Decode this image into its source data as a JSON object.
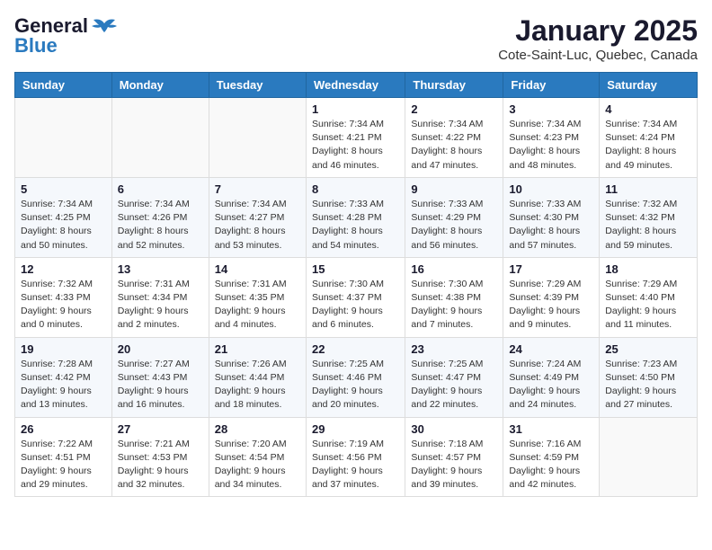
{
  "header": {
    "logo_general": "General",
    "logo_blue": "Blue",
    "month_title": "January 2025",
    "location": "Cote-Saint-Luc, Quebec, Canada"
  },
  "weekdays": [
    "Sunday",
    "Monday",
    "Tuesday",
    "Wednesday",
    "Thursday",
    "Friday",
    "Saturday"
  ],
  "weeks": [
    [
      {
        "day": "",
        "info": ""
      },
      {
        "day": "",
        "info": ""
      },
      {
        "day": "",
        "info": ""
      },
      {
        "day": "1",
        "info": "Sunrise: 7:34 AM\nSunset: 4:21 PM\nDaylight: 8 hours and 46 minutes."
      },
      {
        "day": "2",
        "info": "Sunrise: 7:34 AM\nSunset: 4:22 PM\nDaylight: 8 hours and 47 minutes."
      },
      {
        "day": "3",
        "info": "Sunrise: 7:34 AM\nSunset: 4:23 PM\nDaylight: 8 hours and 48 minutes."
      },
      {
        "day": "4",
        "info": "Sunrise: 7:34 AM\nSunset: 4:24 PM\nDaylight: 8 hours and 49 minutes."
      }
    ],
    [
      {
        "day": "5",
        "info": "Sunrise: 7:34 AM\nSunset: 4:25 PM\nDaylight: 8 hours and 50 minutes."
      },
      {
        "day": "6",
        "info": "Sunrise: 7:34 AM\nSunset: 4:26 PM\nDaylight: 8 hours and 52 minutes."
      },
      {
        "day": "7",
        "info": "Sunrise: 7:34 AM\nSunset: 4:27 PM\nDaylight: 8 hours and 53 minutes."
      },
      {
        "day": "8",
        "info": "Sunrise: 7:33 AM\nSunset: 4:28 PM\nDaylight: 8 hours and 54 minutes."
      },
      {
        "day": "9",
        "info": "Sunrise: 7:33 AM\nSunset: 4:29 PM\nDaylight: 8 hours and 56 minutes."
      },
      {
        "day": "10",
        "info": "Sunrise: 7:33 AM\nSunset: 4:30 PM\nDaylight: 8 hours and 57 minutes."
      },
      {
        "day": "11",
        "info": "Sunrise: 7:32 AM\nSunset: 4:32 PM\nDaylight: 8 hours and 59 minutes."
      }
    ],
    [
      {
        "day": "12",
        "info": "Sunrise: 7:32 AM\nSunset: 4:33 PM\nDaylight: 9 hours and 0 minutes."
      },
      {
        "day": "13",
        "info": "Sunrise: 7:31 AM\nSunset: 4:34 PM\nDaylight: 9 hours and 2 minutes."
      },
      {
        "day": "14",
        "info": "Sunrise: 7:31 AM\nSunset: 4:35 PM\nDaylight: 9 hours and 4 minutes."
      },
      {
        "day": "15",
        "info": "Sunrise: 7:30 AM\nSunset: 4:37 PM\nDaylight: 9 hours and 6 minutes."
      },
      {
        "day": "16",
        "info": "Sunrise: 7:30 AM\nSunset: 4:38 PM\nDaylight: 9 hours and 7 minutes."
      },
      {
        "day": "17",
        "info": "Sunrise: 7:29 AM\nSunset: 4:39 PM\nDaylight: 9 hours and 9 minutes."
      },
      {
        "day": "18",
        "info": "Sunrise: 7:29 AM\nSunset: 4:40 PM\nDaylight: 9 hours and 11 minutes."
      }
    ],
    [
      {
        "day": "19",
        "info": "Sunrise: 7:28 AM\nSunset: 4:42 PM\nDaylight: 9 hours and 13 minutes."
      },
      {
        "day": "20",
        "info": "Sunrise: 7:27 AM\nSunset: 4:43 PM\nDaylight: 9 hours and 16 minutes."
      },
      {
        "day": "21",
        "info": "Sunrise: 7:26 AM\nSunset: 4:44 PM\nDaylight: 9 hours and 18 minutes."
      },
      {
        "day": "22",
        "info": "Sunrise: 7:25 AM\nSunset: 4:46 PM\nDaylight: 9 hours and 20 minutes."
      },
      {
        "day": "23",
        "info": "Sunrise: 7:25 AM\nSunset: 4:47 PM\nDaylight: 9 hours and 22 minutes."
      },
      {
        "day": "24",
        "info": "Sunrise: 7:24 AM\nSunset: 4:49 PM\nDaylight: 9 hours and 24 minutes."
      },
      {
        "day": "25",
        "info": "Sunrise: 7:23 AM\nSunset: 4:50 PM\nDaylight: 9 hours and 27 minutes."
      }
    ],
    [
      {
        "day": "26",
        "info": "Sunrise: 7:22 AM\nSunset: 4:51 PM\nDaylight: 9 hours and 29 minutes."
      },
      {
        "day": "27",
        "info": "Sunrise: 7:21 AM\nSunset: 4:53 PM\nDaylight: 9 hours and 32 minutes."
      },
      {
        "day": "28",
        "info": "Sunrise: 7:20 AM\nSunset: 4:54 PM\nDaylight: 9 hours and 34 minutes."
      },
      {
        "day": "29",
        "info": "Sunrise: 7:19 AM\nSunset: 4:56 PM\nDaylight: 9 hours and 37 minutes."
      },
      {
        "day": "30",
        "info": "Sunrise: 7:18 AM\nSunset: 4:57 PM\nDaylight: 9 hours and 39 minutes."
      },
      {
        "day": "31",
        "info": "Sunrise: 7:16 AM\nSunset: 4:59 PM\nDaylight: 9 hours and 42 minutes."
      },
      {
        "day": "",
        "info": ""
      }
    ]
  ]
}
